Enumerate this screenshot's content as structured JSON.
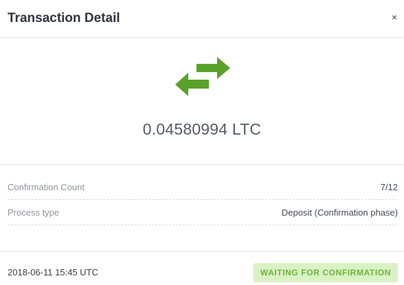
{
  "header": {
    "title": "Transaction Detail",
    "close_label": "×"
  },
  "hero": {
    "icon": "transfer-arrows-icon",
    "icon_color": "#5aa12a",
    "amount": "0.04580994 LTC"
  },
  "details": {
    "rows": [
      {
        "label": "Confirmation Count",
        "value": "7/12"
      },
      {
        "label": "Process type",
        "value": "Deposit (Confirmation phase)"
      }
    ]
  },
  "footer": {
    "timestamp": "2018-06-11 15:45 UTC",
    "status": "WAITING FOR CONFIRMATION",
    "status_color": "#6db33f",
    "status_bg": "#d9f2c3"
  }
}
